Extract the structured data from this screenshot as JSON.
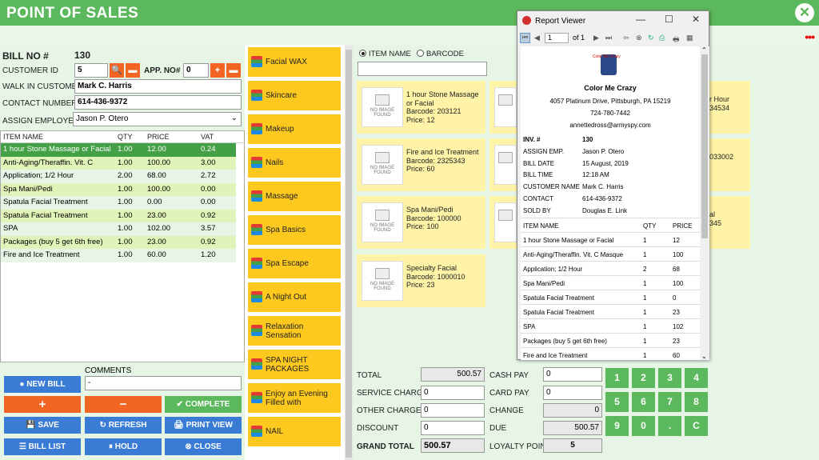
{
  "app": {
    "title": "POINT OF SALES",
    "close_icon": "close-icon",
    "menu_dots": "•••"
  },
  "bill": {
    "bill_no_label": "BILL NO #",
    "bill_no": "130",
    "customer_id_label": "CUSTOMER ID",
    "customer_id": "5",
    "app_no_label": "APP. NO#",
    "app_no": "0",
    "walk_in_label": "WALK IN CUSTOMER",
    "walk_in": "Mark C. Harris",
    "contact_label": "CONTACT NUMBER",
    "contact": "614-436-9372",
    "employee_label": "ASSIGN EMPLOYEE",
    "employee": "Jason P. Otero"
  },
  "items_table": {
    "headers": [
      "ITEM NAME",
      "QTY",
      "PRICE",
      "VAT"
    ],
    "rows": [
      [
        "1 hour Stone Massage or Facial",
        "1.00",
        "12.00",
        "0.24"
      ],
      [
        "Anti-Aging/Theraffin. Vit. C",
        "1.00",
        "100.00",
        "3.00"
      ],
      [
        "Application; 1/2 Hour",
        "2.00",
        "68.00",
        "2.72"
      ],
      [
        "Spa Mani/Pedi",
        "1.00",
        "100.00",
        "0.00"
      ],
      [
        "Spatula Facial Treatment",
        "1.00",
        "0.00",
        "0.00"
      ],
      [
        "Spatula Facial Treatment",
        "1.00",
        "23.00",
        "0.92"
      ],
      [
        "SPA",
        "1.00",
        "102.00",
        "3.57"
      ],
      [
        "Packages (buy 5 get 6th free)",
        "1.00",
        "23.00",
        "0.92"
      ],
      [
        "Fire and Ice Treatment",
        "1.00",
        "60.00",
        "1.20"
      ]
    ]
  },
  "comments": {
    "label": "COMMENTS",
    "value": "-"
  },
  "actions": {
    "new_bill": "NEW BILL",
    "plus": "+",
    "minus": "−",
    "complete": "COMPLETE",
    "save": "SAVE",
    "refresh": "REFRESH",
    "print_view": "PRINT VIEW",
    "bill_list": "BILL LIST",
    "hold": "HOLD",
    "close": "CLOSE"
  },
  "categories": [
    "Facial WAX",
    "Skincare",
    "Makeup",
    "Nails",
    "Massage",
    "Spa Basics",
    "Spa Escape",
    "A Night Out",
    "Relaxation Sensation",
    "SPA NIGHT PACKAGES",
    "Enjoy an Evening Filled with",
    "NAIL"
  ],
  "search": {
    "item_name": "ITEM NAME",
    "barcode": "BARCODE"
  },
  "no_image": "NO IMAGE FOUND",
  "products": [
    {
      "name": "1 hour Stone Massage or Facial",
      "barcode": "Barcode: 203121",
      "price": "Price: 12"
    },
    {
      "name": "Fire and Ice Treatment",
      "barcode": "Barcode: 2325343",
      "price": "Price: 60"
    },
    {
      "name": "Spa Mani/Pedi",
      "barcode": "Barcode: 100000",
      "price": "Price: 100"
    },
    {
      "name": "Specialty Facial",
      "barcode": "Barcode: 1000010",
      "price": "Price: 23"
    }
  ],
  "partial_cards": [
    {
      "name": "r Hour",
      "barcode": "34534"
    },
    {
      "name": "",
      "barcode": "033002"
    },
    {
      "name": "al",
      "barcode": "345"
    }
  ],
  "totals": {
    "total_label": "TOTAL",
    "total": "500.57",
    "service_label": "SERVICE CHARGE",
    "service": "0",
    "other_label": "OTHER CHARGE",
    "other": "0",
    "discount_label": "DISCOUNT",
    "discount": "0",
    "grand_label": "GRAND TOTAL",
    "grand": "500.57",
    "cash_label": "CASH PAY",
    "cash": "0",
    "card_label": "CARD PAY",
    "card": "0",
    "change_label": "CHANGE",
    "change": "0",
    "due_label": "DUE",
    "due": "500.57",
    "loyalty_label": "LOYALTY POINT",
    "loyalty": "5"
  },
  "keypad": [
    "1",
    "2",
    "3",
    "4",
    "5",
    "6",
    "7",
    "8",
    "9",
    "0",
    ".",
    "C"
  ],
  "report": {
    "window_title": "Report Viewer",
    "page": "1",
    "of": "of 1",
    "shop": "Color Me Crazy",
    "logo_text": "Color Me Crazy",
    "address": "4057 Platinum Drive, Pittsburgh, PA 15219",
    "phone": "724-780-7442",
    "email": "annettedross@armyspy.com",
    "fields": [
      [
        "INV. #",
        "130"
      ],
      [
        "ASSIGN EMP.",
        "Jason P. Otero"
      ],
      [
        "BILL DATE",
        "15 August, 2019"
      ],
      [
        "BILL TIME",
        "12:18 AM"
      ],
      [
        "CUSTOMER NAME",
        "Mark C. Harris"
      ],
      [
        "CONTACT",
        "614-436-9372"
      ],
      [
        "SOLD BY",
        "Douglas E. Link"
      ]
    ],
    "table_headers": [
      "ITEM NAME",
      "QTY",
      "PRICE"
    ],
    "rows": [
      [
        "1 hour Stone Massage or Facial",
        "1",
        "12"
      ],
      [
        "Anti-Aging/Theraffin. Vit. C Masque",
        "1",
        "100"
      ],
      [
        "Application; 1/2 Hour",
        "2",
        "68"
      ],
      [
        "Spa Mani/Pedi",
        "1",
        "100"
      ],
      [
        "Spatula Facial Treatment",
        "1",
        "0"
      ],
      [
        "Spatula Facial Treatment",
        "1",
        "23"
      ],
      [
        "SPA",
        "1",
        "102"
      ],
      [
        "Packages (buy 5 get 6th free)",
        "1",
        "23"
      ],
      [
        "Fire and Ice Treatment",
        "1",
        "60"
      ]
    ]
  }
}
